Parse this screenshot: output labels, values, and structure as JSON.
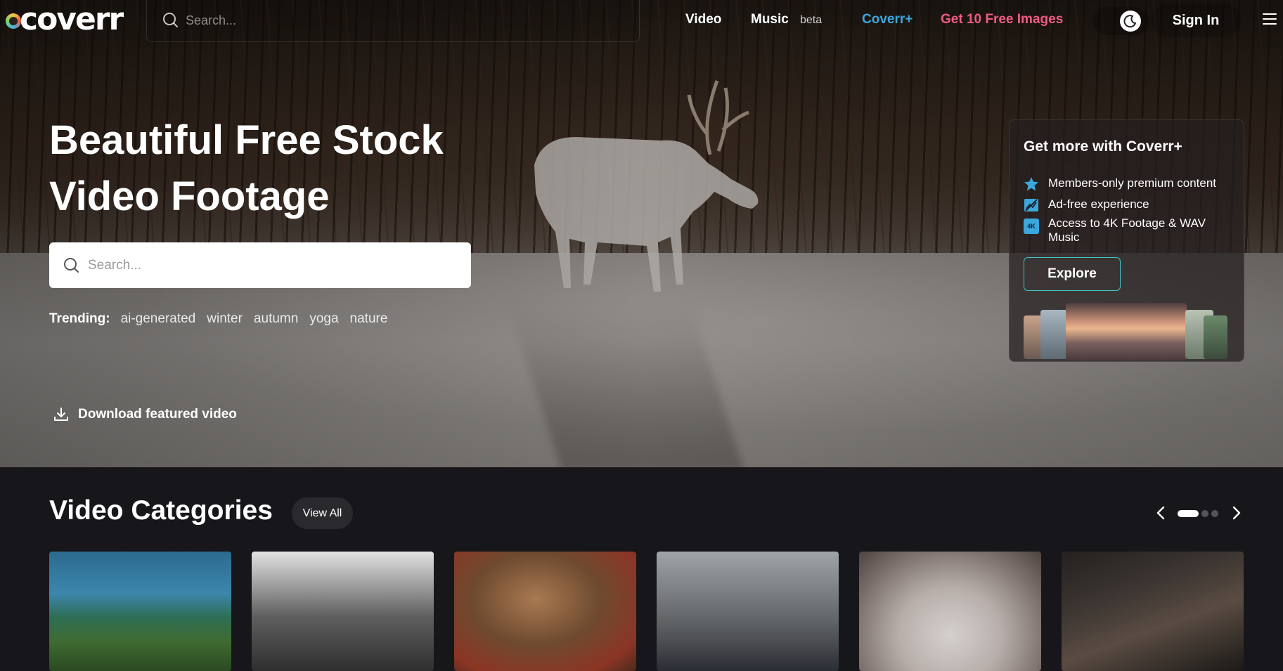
{
  "brand": {
    "logo_text": "coverr"
  },
  "nav": {
    "search_placeholder": "Search...",
    "video": "Video",
    "music": "Music",
    "music_badge": "beta",
    "coverr_plus": "Coverr+",
    "free_images": "Get 10 Free Images",
    "sign_in": "Sign In"
  },
  "hero": {
    "headline_line1": "Beautiful Free Stock",
    "headline_line2": "Video Footage",
    "search_placeholder": "Search...",
    "trending_label": "Trending:",
    "trending_tags": [
      "ai-generated",
      "winter",
      "autumn",
      "yoga",
      "nature"
    ],
    "download_label": "Download featured video"
  },
  "plus_card": {
    "title": "Get more with Coverr+",
    "features": [
      {
        "icon": "star-icon",
        "label": "Members-only premium content"
      },
      {
        "icon": "ad-free-icon",
        "label": "Ad-free experience"
      },
      {
        "icon": "4k-icon",
        "label": "Access to 4K Footage & WAV Music",
        "icon_text": "4K"
      }
    ],
    "explore": "Explore"
  },
  "categories": {
    "title": "Video Categories",
    "view_all": "View All",
    "pager": {
      "pages": 3,
      "active": 1
    }
  },
  "colors": {
    "accent_teal": "#41c6c7",
    "coverr_plus_blue": "#3ba7dd",
    "free_images_pink": "#ef5b84",
    "page_bg": "#17161a"
  }
}
